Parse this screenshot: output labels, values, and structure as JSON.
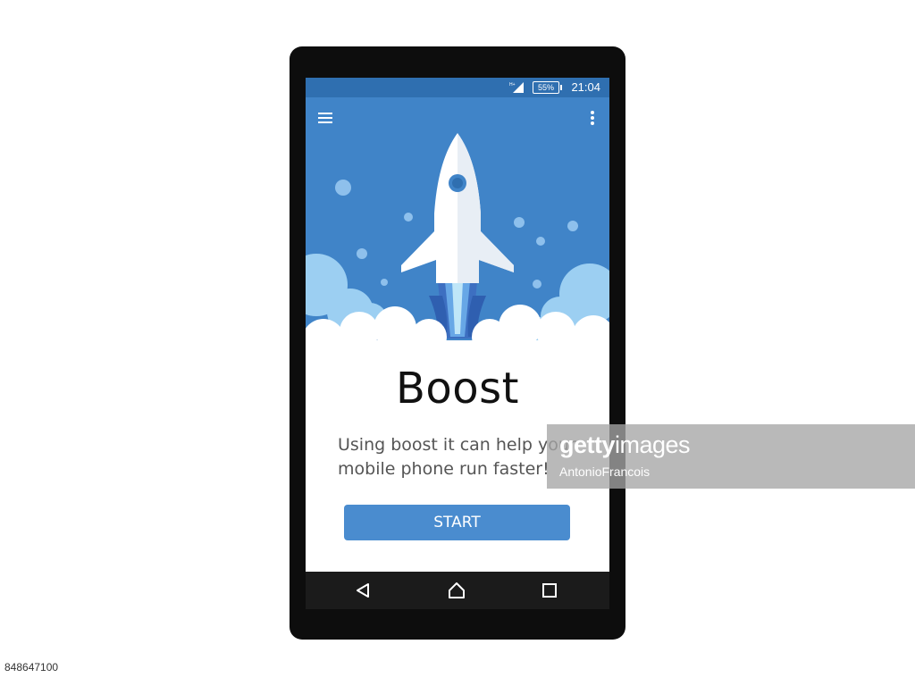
{
  "status_bar": {
    "network": "H+",
    "battery": "55%",
    "time": "21:04"
  },
  "toolbar": {
    "menu_icon": "hamburger-menu-icon",
    "more_icon": "more-vert-icon"
  },
  "hero": {
    "illustration": "rocket-icon",
    "colors": {
      "sky": "#4084c8",
      "rocket": "#ffffff",
      "flame_dark": "#3d6fc1",
      "flame_light": "#8fd0f0",
      "clouds": "#ffffff",
      "clouds_back": "#9ccff2"
    }
  },
  "content": {
    "title": "Boost",
    "description_line1": "Using boost it can help your",
    "description_line2": "mobile phone run faster!",
    "start_label": "START"
  },
  "nav_bar": {
    "back_icon": "back-triangle-icon",
    "home_icon": "home-icon",
    "recent_icon": "recent-apps-icon"
  },
  "watermark": {
    "brand_bold": "getty",
    "brand_rest": "images",
    "author": "AntonioFrancois"
  },
  "image_id": "848647100",
  "accent_color": "#4a8ccf"
}
